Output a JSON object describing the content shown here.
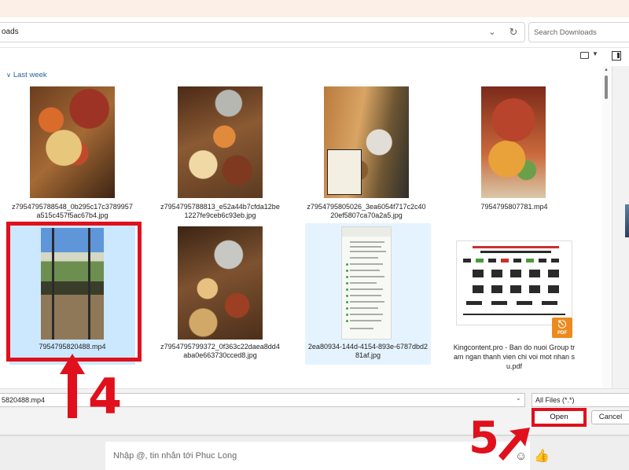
{
  "address": {
    "text": "oads"
  },
  "search": {
    "placeholder": "Search Downloads"
  },
  "group": {
    "label": "Last week"
  },
  "files": [
    {
      "name": "z7954795788548_0b295c17c3789957a515c457f5ac67b4.jpg"
    },
    {
      "name": "z7954795788813_e52a44b7cfda12be1227fe9ceb6c93eb.jpg"
    },
    {
      "name": "z7954795805026_3ea6054f717c2c4020ef5807ca70a2a5.jpg"
    },
    {
      "name": "7954795807781.mp4"
    },
    {
      "name": "7954795820488.mp4"
    },
    {
      "name": "z7954795799372_0f363c22daea8dd4aba0e663730cced8.jpg"
    },
    {
      "name": "2ea80934-144d-4154-893e-6787dbd281af.jpg"
    },
    {
      "name": "Kingcontent.pro - Ban do nuoi Group tram ngan thanh vien chi voi mot nhan su.pdf"
    }
  ],
  "pdf_badge": "PDF",
  "filename_field": {
    "value": "5820488.mp4"
  },
  "filetype": {
    "value": "All Files (*.*)"
  },
  "buttons": {
    "open": "Open",
    "cancel": "Cancel"
  },
  "chat": {
    "placeholder": "Nhập @, tin nhắn tới Phuc Long"
  },
  "annotations": {
    "step4": "4",
    "step5": "5"
  },
  "colors": {
    "annotation_red": "#e0101c",
    "selected_tile": "#cce8ff",
    "group_link": "#2a5f9e"
  },
  "icons": [
    "chevron-down-icon",
    "refresh-icon",
    "view-mode-icon",
    "preview-pane-icon",
    "emoji-icon",
    "thumbs-up-icon"
  ]
}
